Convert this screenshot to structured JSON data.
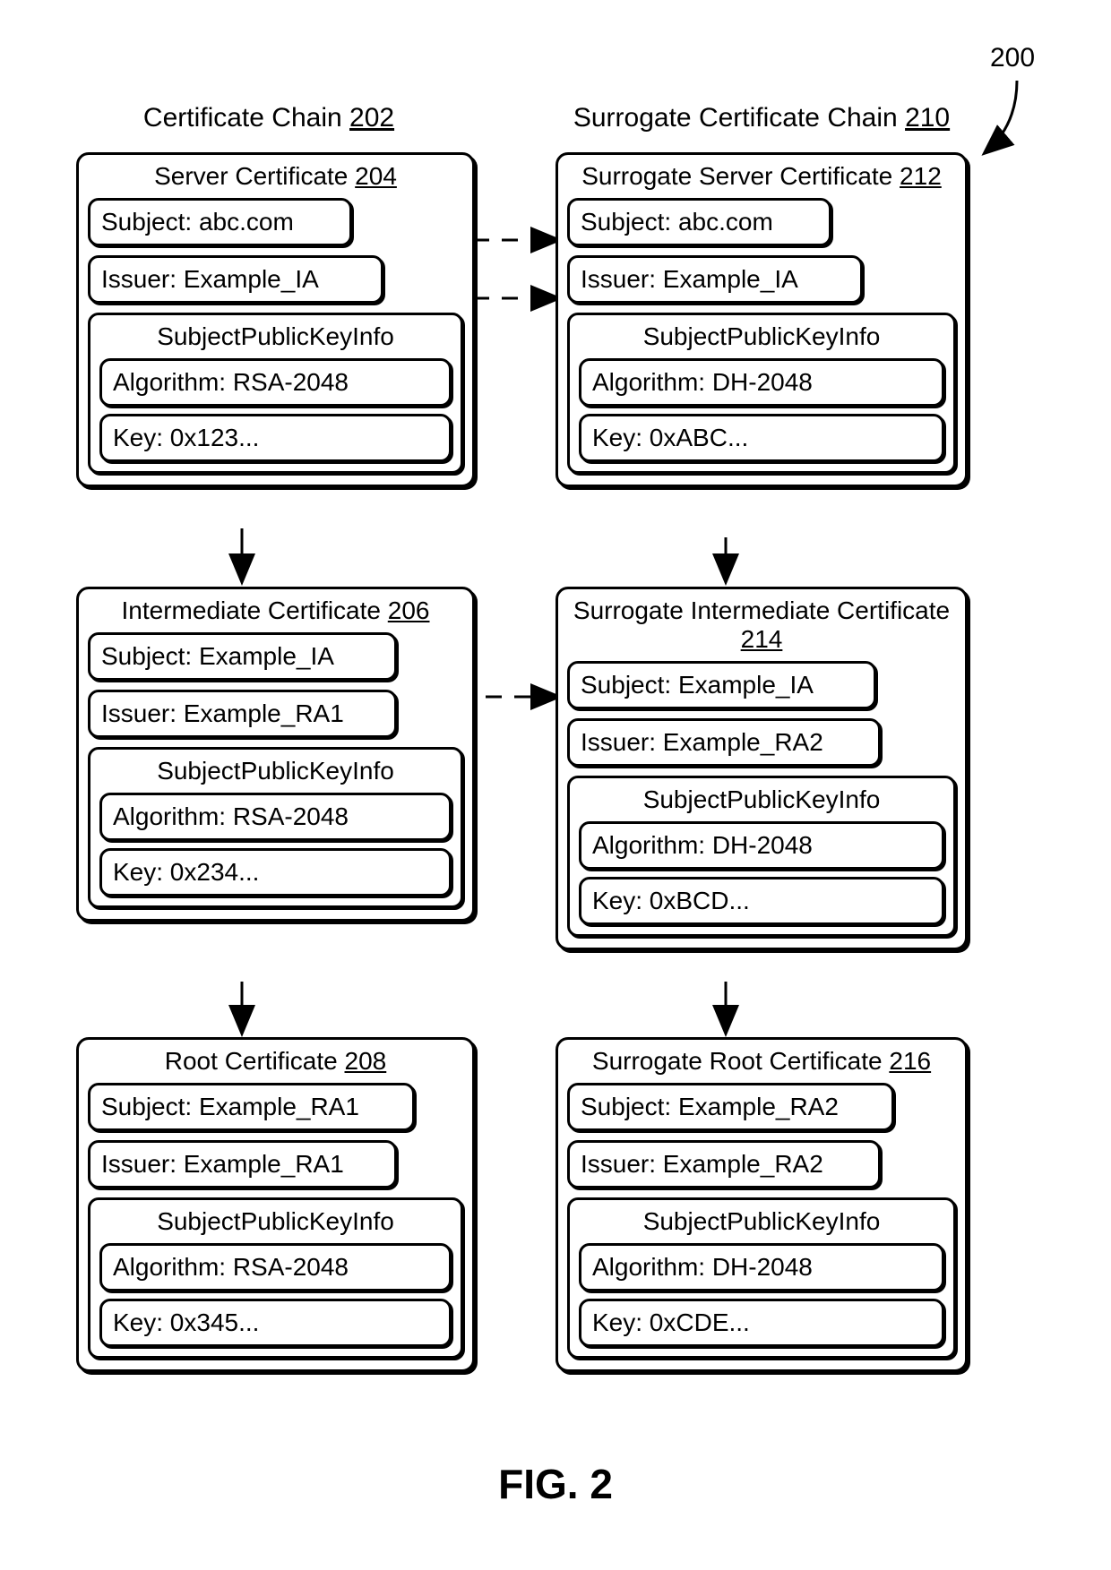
{
  "figure_ref": "200",
  "figure_label": "FIG. 2",
  "left_chain": {
    "title": "Certificate Chain",
    "ref": "202",
    "certs": [
      {
        "title": "Server Certificate",
        "ref": "204",
        "subject": "Subject: abc.com",
        "issuer": "Issuer: Example_IA",
        "spki_label": "SubjectPublicKeyInfo",
        "algorithm": "Algorithm: RSA-2048",
        "key": "Key: 0x123..."
      },
      {
        "title": "Intermediate Certificate",
        "ref": "206",
        "subject": "Subject: Example_IA",
        "issuer": "Issuer: Example_RA1",
        "spki_label": "SubjectPublicKeyInfo",
        "algorithm": "Algorithm: RSA-2048",
        "key": "Key: 0x234..."
      },
      {
        "title": "Root Certificate",
        "ref": "208",
        "subject": "Subject: Example_RA1",
        "issuer": "Issuer: Example_RA1",
        "spki_label": "SubjectPublicKeyInfo",
        "algorithm": "Algorithm: RSA-2048",
        "key": "Key: 0x345..."
      }
    ]
  },
  "right_chain": {
    "title": "Surrogate Certificate Chain",
    "ref": "210",
    "certs": [
      {
        "title": "Surrogate Server Certificate",
        "ref": "212",
        "subject": "Subject: abc.com",
        "issuer": "Issuer: Example_IA",
        "spki_label": "SubjectPublicKeyInfo",
        "algorithm": "Algorithm: DH-2048",
        "key": "Key: 0xABC..."
      },
      {
        "title": "Surrogate Intermediate Certificate",
        "ref": "214",
        "subject": "Subject: Example_IA",
        "issuer": "Issuer: Example_RA2",
        "spki_label": "SubjectPublicKeyInfo",
        "algorithm": "Algorithm: DH-2048",
        "key": "Key: 0xBCD..."
      },
      {
        "title": "Surrogate Root Certificate",
        "ref": "216",
        "subject": "Subject: Example_RA2",
        "issuer": "Issuer: Example_RA2",
        "spki_label": "SubjectPublicKeyInfo",
        "algorithm": "Algorithm: DH-2048",
        "key": "Key: 0xCDE..."
      }
    ]
  }
}
